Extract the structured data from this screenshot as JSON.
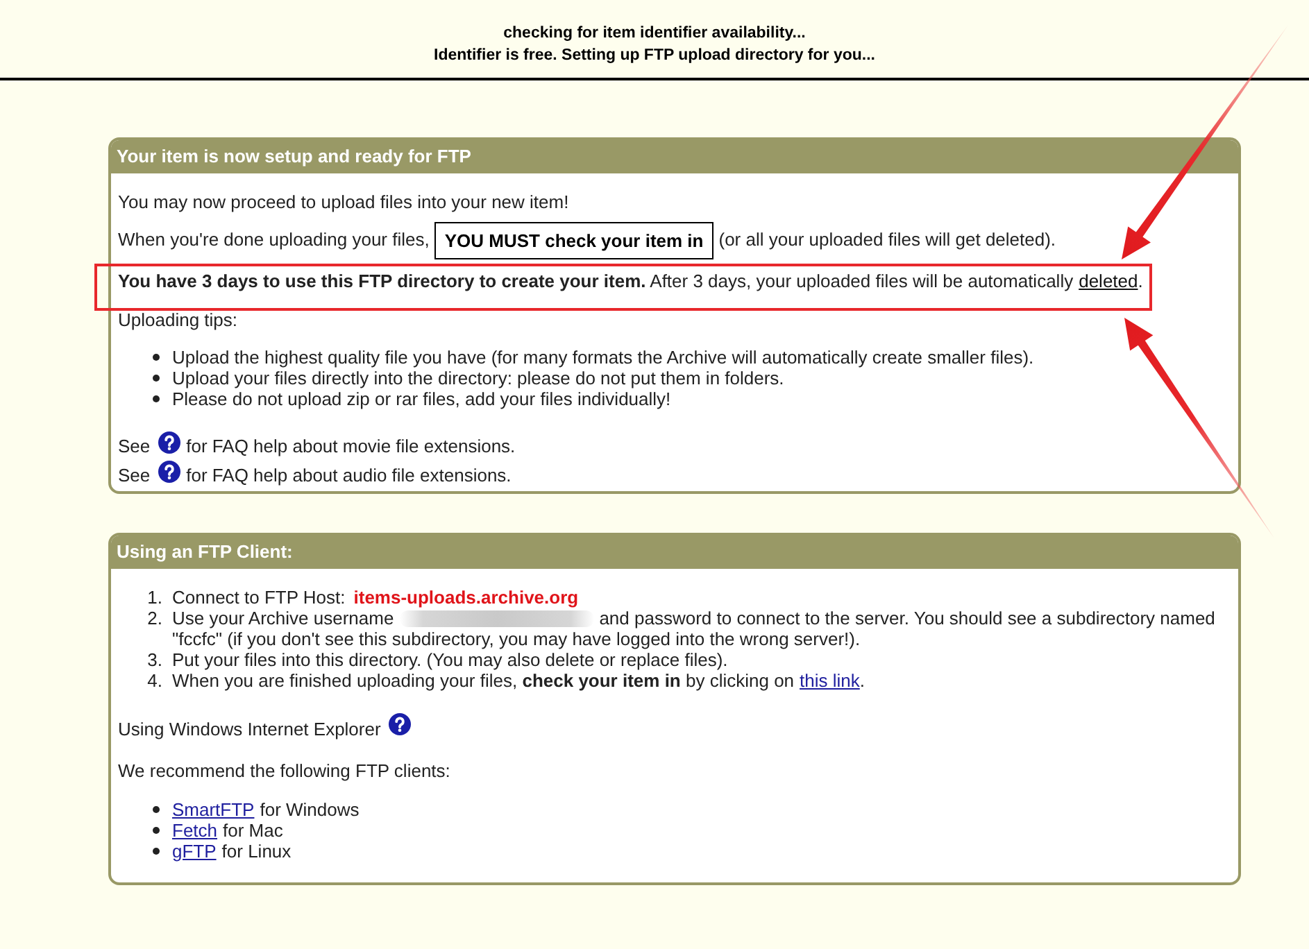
{
  "status": {
    "lines": [
      "checking for item identifier availability...",
      "Identifier is free. Setting up FTP upload directory for you..."
    ]
  },
  "ready_panel": {
    "title": "Your item is now setup and ready for FTP",
    "intro": "You may now proceed to upload files into your new item!",
    "checkin": {
      "before": "When you're done uploading your files,",
      "callout": "YOU MUST check your item in",
      "after": "(or all your uploaded files will get deleted)."
    },
    "warning": {
      "highlighted": true,
      "text": "**You have 3 days to use this FTP directory to create your item.** After 3 days, your uploaded files will be automatically",
      "link": "deleted",
      "end": "."
    },
    "tips_label": "Uploading tips:",
    "tips": [
      "Upload the highest quality file you have (for many formats the Archive will automatically create smaller files).",
      "Upload your files directly into the directory: please do not put them in folders.",
      "Please do not upload zip or rar files, add your files individually!"
    ],
    "faq": [
      {
        "before": "See",
        "after": "for FAQ help about movie file extensions."
      },
      {
        "before": "See",
        "after": "for FAQ help about audio file extensions."
      }
    ]
  },
  "client_panel": {
    "title": "Using an FTP Client:",
    "steps": [
      {
        "kind": "host",
        "number": "1.",
        "text": "Connect to FTP Host:",
        "host": "items-uploads.archive.org"
      },
      {
        "kind": "redacted",
        "number": "2.",
        "text": "Use your Archive username",
        "after": "and password to connect to the server. You should see a subdirectory named \"fccfc\" (if you don't see this subdirectory, you may have logged into the wrong server!)."
      },
      {
        "kind": "plain",
        "number": "3.",
        "text": "Put your files into this directory. (You may also delete or replace files)."
      },
      {
        "kind": "link",
        "number": "4.",
        "text": "When you are finished uploading your files, **check your item in** by clicking on",
        "link": "this link",
        "end": "."
      }
    ],
    "ie_label": "Using Windows Internet Explorer",
    "recommend_label": "We recommend the following FTP clients:",
    "clients": [
      {
        "link": "SmartFTP",
        "text": "for Windows"
      },
      {
        "link": "Fetch",
        "text": "for Mac"
      },
      {
        "link": "gFTP",
        "text": "for Linux"
      }
    ]
  }
}
